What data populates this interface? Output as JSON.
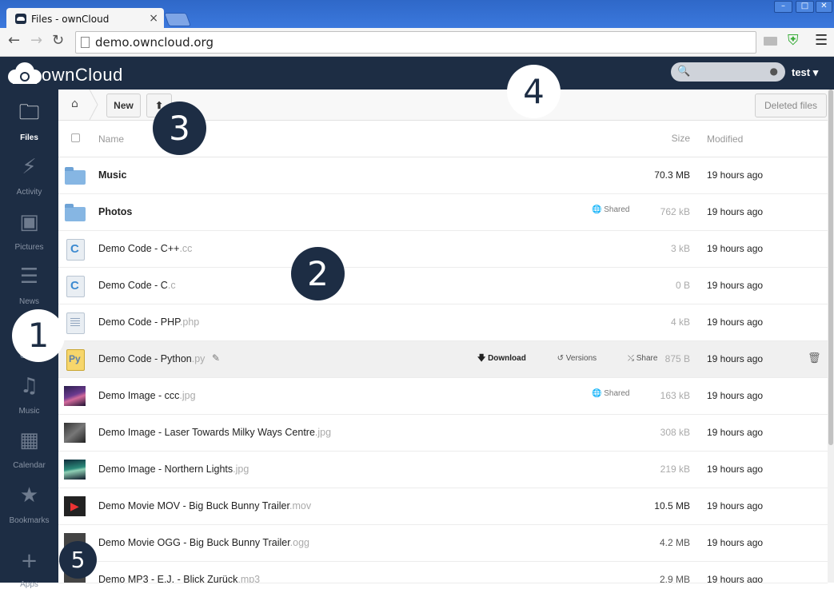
{
  "browser": {
    "tab_title": "Files - ownCloud",
    "tab_close": "×",
    "url": "demo.owncloud.org",
    "win_min": "–",
    "win_max": "□",
    "win_close": "✕"
  },
  "header": {
    "logo_text": "ownCloud",
    "user": "test ▾"
  },
  "apps": [
    {
      "label": "Files",
      "icon": "folder-icon"
    },
    {
      "label": "Activity",
      "icon": "lightning-icon"
    },
    {
      "label": "Pictures",
      "icon": "image-icon"
    },
    {
      "label": "News",
      "icon": "lines-icon"
    },
    {
      "label": "C",
      "icon": "contacts-icon"
    },
    {
      "label": "Music",
      "icon": "music-note-icon"
    },
    {
      "label": "Calendar",
      "icon": "calendar-icon"
    },
    {
      "label": "Bookmarks",
      "icon": "star-icon"
    },
    {
      "label": "Apps",
      "icon": "plus-icon"
    }
  ],
  "controls": {
    "new_label": "New",
    "deleted_files_label": "Deleted files"
  },
  "table": {
    "col_name": "Name",
    "col_size": "Size",
    "col_modified": "Modified"
  },
  "files": [
    {
      "name": "Music",
      "ext": "",
      "size": "70.3 MB",
      "modified": "19 hours ago",
      "kind": "folder",
      "shared": "",
      "size_color": "#222"
    },
    {
      "name": "Photos",
      "ext": "",
      "size": "762 kB",
      "modified": "19 hours ago",
      "kind": "folder",
      "shared": "Shared",
      "size_color": "#aaa"
    },
    {
      "name": "Demo Code - C++",
      "ext": ".cc",
      "size": "3 kB",
      "modified": "19 hours ago",
      "kind": "code-c",
      "shared": "",
      "size_color": "#aaa"
    },
    {
      "name": "Demo Code - C",
      "ext": ".c",
      "size": "0 B",
      "modified": "19 hours ago",
      "kind": "code-c",
      "shared": "",
      "size_color": "#aaa"
    },
    {
      "name": "Demo Code - PHP",
      "ext": ".php",
      "size": "4 kB",
      "modified": "19 hours ago",
      "kind": "text",
      "shared": "",
      "size_color": "#aaa"
    },
    {
      "name": "Demo Code - Python",
      "ext": ".py",
      "size": "875 B",
      "modified": "19 hours ago",
      "kind": "python",
      "shared": "",
      "size_color": "#aaa"
    },
    {
      "name": "Demo Image - ccc",
      "ext": ".jpg",
      "size": "163 kB",
      "modified": "19 hours ago",
      "kind": "image1",
      "shared": "Shared",
      "size_color": "#aaa"
    },
    {
      "name": "Demo Image - Laser Towards Milky Ways Centre",
      "ext": ".jpg",
      "size": "308 kB",
      "modified": "19 hours ago",
      "kind": "image2",
      "shared": "",
      "size_color": "#aaa"
    },
    {
      "name": "Demo Image - Northern Lights",
      "ext": ".jpg",
      "size": "219 kB",
      "modified": "19 hours ago",
      "kind": "image3",
      "shared": "",
      "size_color": "#aaa"
    },
    {
      "name": "Demo Movie MOV - Big Buck Bunny Trailer",
      "ext": ".mov",
      "size": "10.5 MB",
      "modified": "19 hours ago",
      "kind": "movie",
      "shared": "",
      "size_color": "#222"
    },
    {
      "name": "Demo Movie OGG - Big Buck Bunny Trailer",
      "ext": ".ogg",
      "size": "4.2 MB",
      "modified": "19 hours ago",
      "kind": "movie2",
      "shared": "",
      "size_color": "#555"
    },
    {
      "name": "Demo MP3 - E.J. - Blick Zurück",
      "ext": ".mp3",
      "size": "2.9 MB",
      "modified": "19 hours ago",
      "kind": "audio",
      "shared": "",
      "size_color": "#555"
    }
  ],
  "row_actions": {
    "download": "Download",
    "versions": "Versions",
    "share": "Share"
  },
  "callouts": [
    "1",
    "2",
    "3",
    "4",
    "5"
  ],
  "colors": {
    "header_bg": "#1d2d44",
    "accent_browser": "#3b78dd"
  }
}
